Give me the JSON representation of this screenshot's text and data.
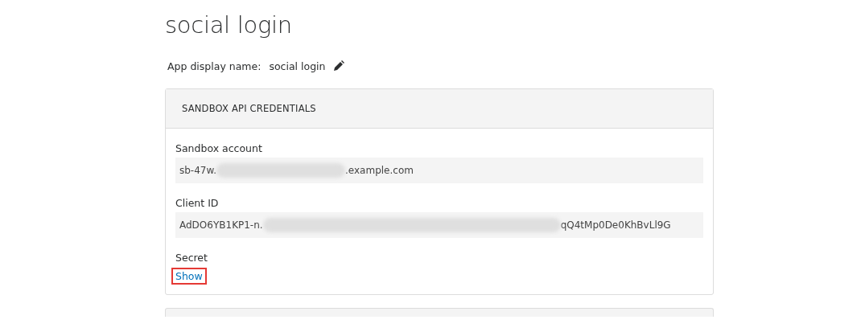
{
  "title": "social login",
  "app_display_name": {
    "label": "App display name:",
    "value": "social login"
  },
  "credentials_card": {
    "heading": "SANDBOX API CREDENTIALS",
    "fields": [
      {
        "kind": "redacted",
        "label": "Sandbox account",
        "value_start": "sb-47w.",
        "value_end": ".example.com"
      },
      {
        "kind": "redacted",
        "label": "Client ID",
        "value_start": "AdDO6YB1KP1-n.",
        "value_end": "qQ4tMp0De0KhBvLl9G"
      },
      {
        "kind": "link",
        "label": "Secret",
        "link": "Show",
        "highlighted": true
      }
    ]
  }
}
